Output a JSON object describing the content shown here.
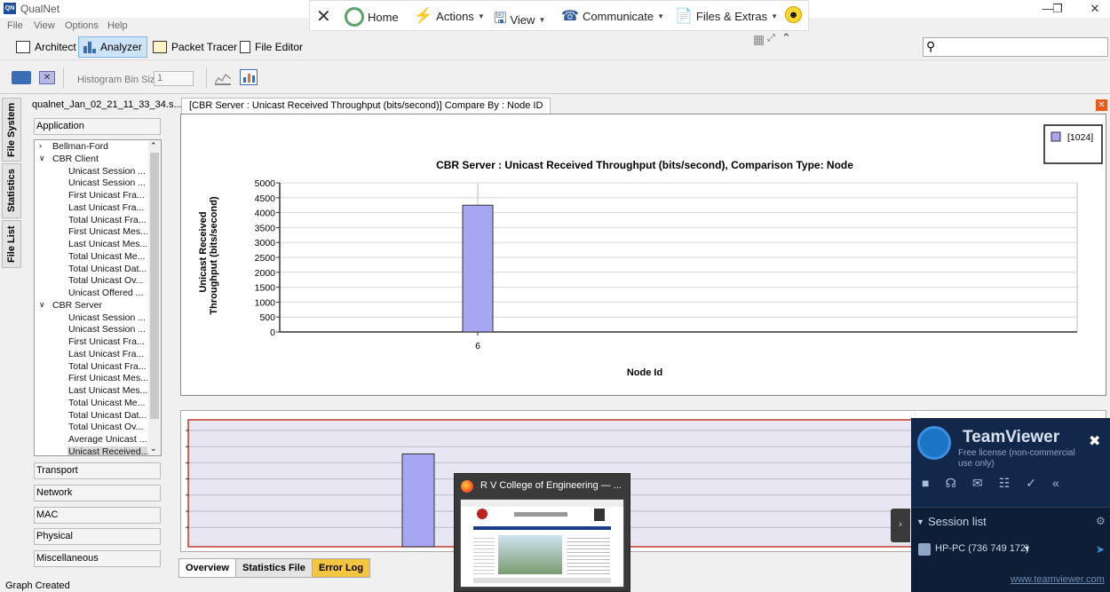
{
  "app": {
    "title": "QualNet",
    "icon_text": "QN"
  },
  "menu": [
    "File",
    "View",
    "Options",
    "Help"
  ],
  "teamviewer_bar": {
    "items": [
      {
        "label": "Home",
        "icon": "home-icon"
      },
      {
        "label": "Actions",
        "icon": "lightning-icon"
      },
      {
        "label": "View",
        "icon": "monitor-icon"
      },
      {
        "label": "Communicate",
        "icon": "phone-icon"
      },
      {
        "label": "Files & Extras",
        "icon": "files-icon"
      }
    ]
  },
  "toolbar": {
    "buttons": [
      {
        "label": "Architect",
        "active": false
      },
      {
        "label": "Analyzer",
        "active": true
      },
      {
        "label": "Packet Tracer",
        "active": false
      },
      {
        "label": "File Editor",
        "active": false
      }
    ]
  },
  "histogram": {
    "label": "Histogram Bin Size",
    "value": "1"
  },
  "vertical_tabs": [
    "File System",
    "Statistics",
    "File List"
  ],
  "left_panel": {
    "file_name": "qualnet_Jan_02_21_11_33_34.s...",
    "top_category": "Application",
    "tree": [
      {
        "text": "Bellman-Ford",
        "level": 0,
        "expander": ">"
      },
      {
        "text": "CBR Client",
        "level": 0,
        "expander": "v"
      },
      {
        "text": "Unicast Session ...",
        "level": 2
      },
      {
        "text": "Unicast Session ...",
        "level": 2
      },
      {
        "text": "First Unicast Fra...",
        "level": 2
      },
      {
        "text": "Last Unicast Fra...",
        "level": 2
      },
      {
        "text": "Total Unicast Fra...",
        "level": 2
      },
      {
        "text": "First Unicast Mes...",
        "level": 2
      },
      {
        "text": "Last Unicast Mes...",
        "level": 2
      },
      {
        "text": "Total Unicast Me...",
        "level": 2
      },
      {
        "text": "Total Unicast Dat...",
        "level": 2
      },
      {
        "text": "Total Unicast Ov...",
        "level": 2
      },
      {
        "text": "Unicast Offered ...",
        "level": 2
      },
      {
        "text": "CBR Server",
        "level": 0,
        "expander": "v"
      },
      {
        "text": "Unicast Session ...",
        "level": 2
      },
      {
        "text": "Unicast Session ...",
        "level": 2
      },
      {
        "text": "First Unicast Fra...",
        "level": 2
      },
      {
        "text": "Last Unicast Fra...",
        "level": 2
      },
      {
        "text": "Total Unicast Fra...",
        "level": 2
      },
      {
        "text": "First Unicast Mes...",
        "level": 2
      },
      {
        "text": "Last Unicast Mes...",
        "level": 2
      },
      {
        "text": "Total Unicast Me...",
        "level": 2
      },
      {
        "text": "Total Unicast Dat...",
        "level": 2
      },
      {
        "text": "Total Unicast Ov...",
        "level": 2
      },
      {
        "text": "Average Unicast ...",
        "level": 2
      },
      {
        "text": "Unicast Received...",
        "level": 2,
        "selected": true
      }
    ],
    "categories": [
      "Transport",
      "Network",
      "MAC",
      "Physical",
      "Miscellaneous"
    ]
  },
  "tab_header": "[CBR Server :  Unicast Received Throughput (bits/second)] Compare By : Node ID",
  "chart_data": {
    "type": "bar",
    "title": "CBR Server :  Unicast Received Throughput (bits/second), Comparison Type: Node",
    "xlabel": "Node Id",
    "ylabel_line1": "Unicast Received",
    "ylabel_line2": "Throughput (bits/second)",
    "categories": [
      "6"
    ],
    "series": [
      {
        "name": "[1024]",
        "values": [
          4250
        ],
        "color": "#a6a6f2"
      }
    ],
    "ylim": [
      0,
      5000
    ],
    "yticks": [
      "0",
      "500",
      "1000",
      "1500",
      "2000",
      "2500",
      "3000",
      "3500",
      "4000",
      "4500",
      "5000"
    ],
    "grid": true,
    "legend_position": "top-right"
  },
  "bottom_tabs": [
    {
      "label": "Overview",
      "color": "#ffffff"
    },
    {
      "label": "Statistics File",
      "color": "#e4e4e4"
    },
    {
      "label": "Error Log",
      "color": "#f5c542"
    }
  ],
  "status": "Graph Created",
  "teamviewer_panel": {
    "name": "TeamViewer",
    "subtitle": "Free license (non-commercial use only)",
    "session_list": "Session list",
    "session_item": "HP-PC (736 749 172)",
    "link": "www.teamviewer.com"
  },
  "firefox_popup": {
    "title": "R V College of Engineering — ..."
  }
}
